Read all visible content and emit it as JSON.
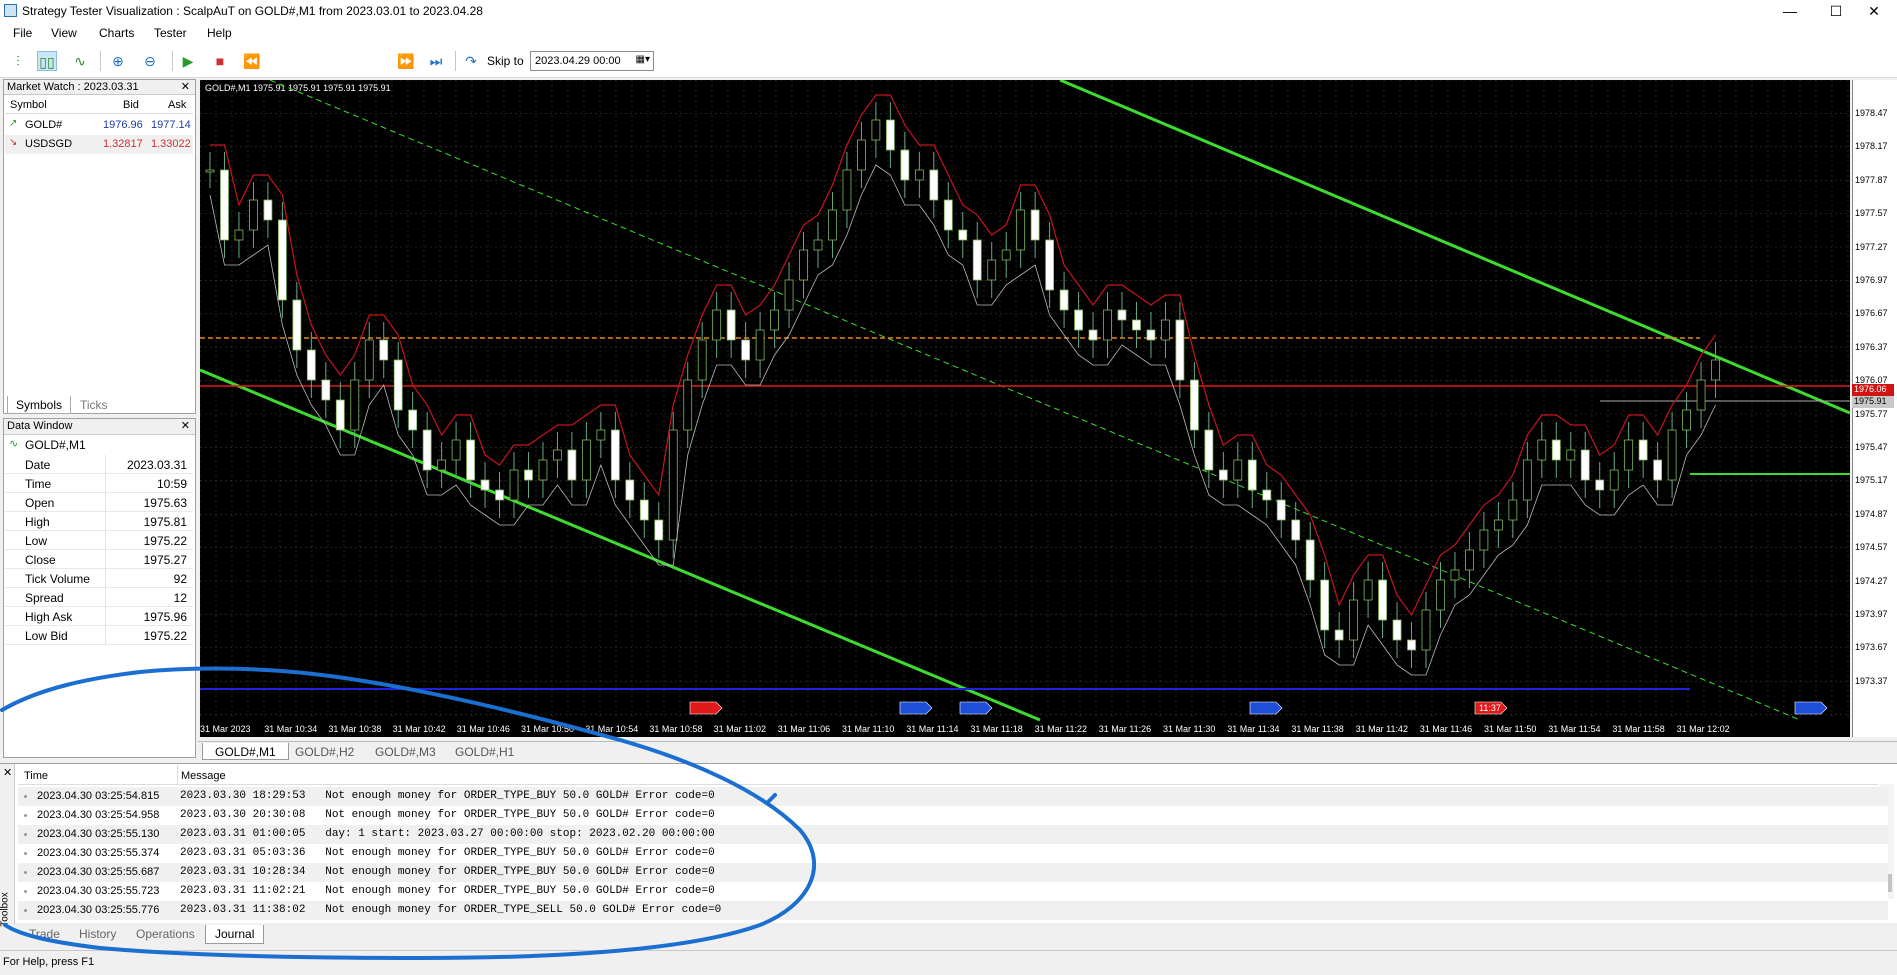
{
  "window": {
    "title": "Strategy Tester Visualization : ScalpAuT on GOLD#,M1 from 2023.03.01 to 2023.04.28"
  },
  "menu": [
    "File",
    "View",
    "Charts",
    "Tester",
    "Help"
  ],
  "toolbar": {
    "skip_label": "Skip to",
    "skip_date": "2023.04.29 00:00"
  },
  "market_watch": {
    "title": "Market Watch : 2023.03.31",
    "headers": {
      "symbol": "Symbol",
      "bid": "Bid",
      "ask": "Ask"
    },
    "rows": [
      {
        "symbol": "GOLD#",
        "bid": "1976.96",
        "ask": "1977.14"
      },
      {
        "symbol": "USDSGD",
        "bid": "1.32817",
        "ask": "1.33022"
      }
    ],
    "tabs": [
      "Symbols",
      "Ticks"
    ]
  },
  "data_window": {
    "title": "Data Window",
    "symbol": "GOLD#,M1",
    "rows": [
      {
        "label": "Date",
        "value": "2023.03.31"
      },
      {
        "label": "Time",
        "value": "10:59"
      },
      {
        "label": "Open",
        "value": "1975.63"
      },
      {
        "label": "High",
        "value": "1975.81"
      },
      {
        "label": "Low",
        "value": "1975.22"
      },
      {
        "label": "Close",
        "value": "1975.27"
      },
      {
        "label": "Tick Volume",
        "value": "92"
      },
      {
        "label": "Spread",
        "value": "12"
      },
      {
        "label": "High Ask",
        "value": "1975.96"
      },
      {
        "label": "Low Bid",
        "value": "1975.22"
      }
    ]
  },
  "chart": {
    "header": "GOLD#,M1  1975.91 1975.91 1975.91 1975.91",
    "price_labels": [
      "1978.47",
      "1978.17",
      "1977.87",
      "1977.57",
      "1977.27",
      "1976.97",
      "1976.67",
      "1976.37",
      "1976.07",
      "1975.77",
      "1975.47",
      "1975.17",
      "1974.87",
      "1974.57",
      "1974.27",
      "1973.97",
      "1973.67",
      "1973.37"
    ],
    "time_labels": [
      "31 Mar 2023",
      "31 Mar 10:34",
      "31 Mar 10:38",
      "31 Mar 10:42",
      "31 Mar 10:46",
      "31 Mar 10:50",
      "31 Mar 10:54",
      "31 Mar 10:58",
      "31 Mar 11:02",
      "31 Mar 11:06",
      "31 Mar 11:10",
      "31 Mar 11:14",
      "31 Mar 11:18",
      "31 Mar 11:22",
      "31 Mar 11:26",
      "31 Mar 11:30",
      "31 Mar 11:34",
      "31 Mar 11:38",
      "31 Mar 11:42",
      "31 Mar 11:46",
      "31 Mar 11:50",
      "31 Mar 11:54",
      "31 Mar 11:58",
      "31 Mar 12:02"
    ],
    "bid_marker": "1976.06",
    "ask_marker": "1975.91",
    "order_marker": "11:37",
    "tabs": [
      "GOLD#,M1",
      "GOLD#,H2",
      "GOLD#,M3",
      "GOLD#,H1"
    ]
  },
  "journal": {
    "headers": {
      "time": "Time",
      "message": "Message"
    },
    "rows": [
      {
        "time": "2023.04.30 03:25:54.815",
        "message": "2023.03.30 18:29:53   Not enough money for ORDER_TYPE_BUY 50.0 GOLD# Error code=0"
      },
      {
        "time": "2023.04.30 03:25:54.958",
        "message": "2023.03.30 20:30:08   Not enough money for ORDER_TYPE_BUY 50.0 GOLD# Error code=0"
      },
      {
        "time": "2023.04.30 03:25:55.130",
        "message": "2023.03.31 01:00:05   day: 1 start: 2023.03.27 00:00:00 stop: 2023.02.20 00:00:00"
      },
      {
        "time": "2023.04.30 03:25:55.374",
        "message": "2023.03.31 05:03:36   Not enough money for ORDER_TYPE_BUY 50.0 GOLD# Error code=0"
      },
      {
        "time": "2023.04.30 03:25:55.687",
        "message": "2023.03.31 10:28:34   Not enough money for ORDER_TYPE_BUY 50.0 GOLD# Error code=0"
      },
      {
        "time": "2023.04.30 03:25:55.723",
        "message": "2023.03.31 11:02:21   Not enough money for ORDER_TYPE_BUY 50.0 GOLD# Error code=0"
      },
      {
        "time": "2023.04.30 03:25:55.776",
        "message": "2023.03.31 11:38:02   Not enough money for ORDER_TYPE_SELL 50.0 GOLD# Error code=0"
      }
    ],
    "tabs": [
      "Trade",
      "History",
      "Operations",
      "Journal"
    ],
    "side_label": "Toolbox"
  },
  "status": {
    "help": "For Help, press F1"
  },
  "colors": {
    "annotation": "#1a6fd0",
    "trend": "#3ddc2f",
    "candle": "#ffffff",
    "ma": "#c8141e"
  }
}
